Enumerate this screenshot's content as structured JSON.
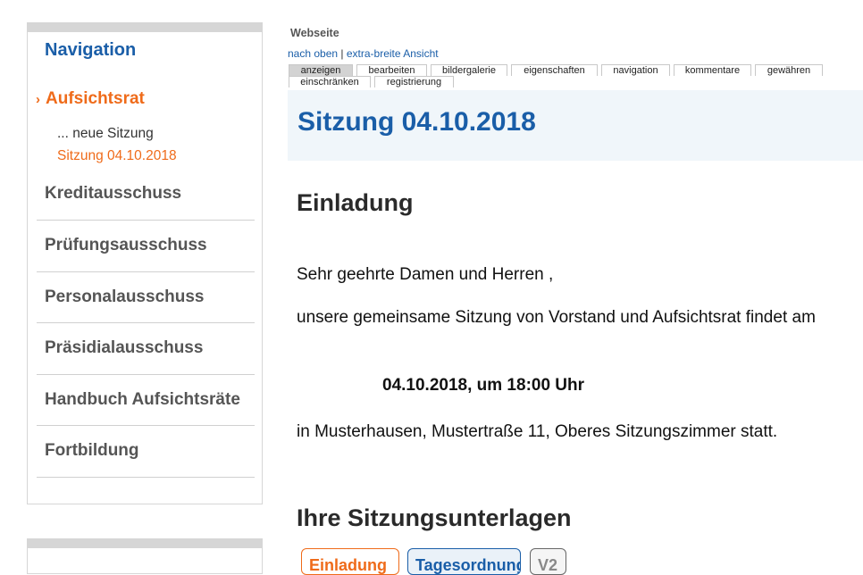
{
  "sidebar": {
    "heading": "Navigation",
    "active_item": "Aufsichtsrat",
    "sub_items": [
      "... neue Sitzung",
      "Sitzung 04.10.2018"
    ],
    "items": [
      "Kreditausschuss",
      "Prüfungsausschuss",
      "Personalausschuss",
      "Präsidialausschuss",
      "Handbuch Aufsichtsräte",
      "Fortbildung"
    ]
  },
  "header": {
    "site_label": "Webseite",
    "links": {
      "up": "nach oben",
      "separator": "|",
      "wide": "extra-breite Ansicht"
    },
    "tabs_row1": [
      "anzeigen",
      "bearbeiten",
      "bildergalerie",
      "eigenschaften",
      "navigation",
      "kommentare",
      "gewähren"
    ],
    "tabs_row2": [
      "einschränken",
      "registrierung"
    ],
    "active_tab": "anzeigen"
  },
  "main": {
    "title": "Sitzung 04.10.2018",
    "invitation_heading": "Einladung",
    "greeting": "Sehr geehrte Damen und Herren ,",
    "body_text": "unsere gemeinsame Sitzung von Vorstand und Aufsichtsrat findet am",
    "date_line": "04.10.2018, um 18:00 Uhr",
    "location_text": "in Musterhausen, Mustertraße 11, Oberes Sitzungszimmer statt.",
    "documents_heading": "Ihre Sitzungsunterlagen",
    "buttons": [
      "Einladung",
      "Tagesordnung",
      "V2"
    ]
  },
  "colors": {
    "accent_blue": "#1a5ea8",
    "accent_orange": "#ef6b1a",
    "title_bg": "#f0f6fa"
  },
  "icons": {
    "active_item_marker": "chevron-right-icon"
  }
}
